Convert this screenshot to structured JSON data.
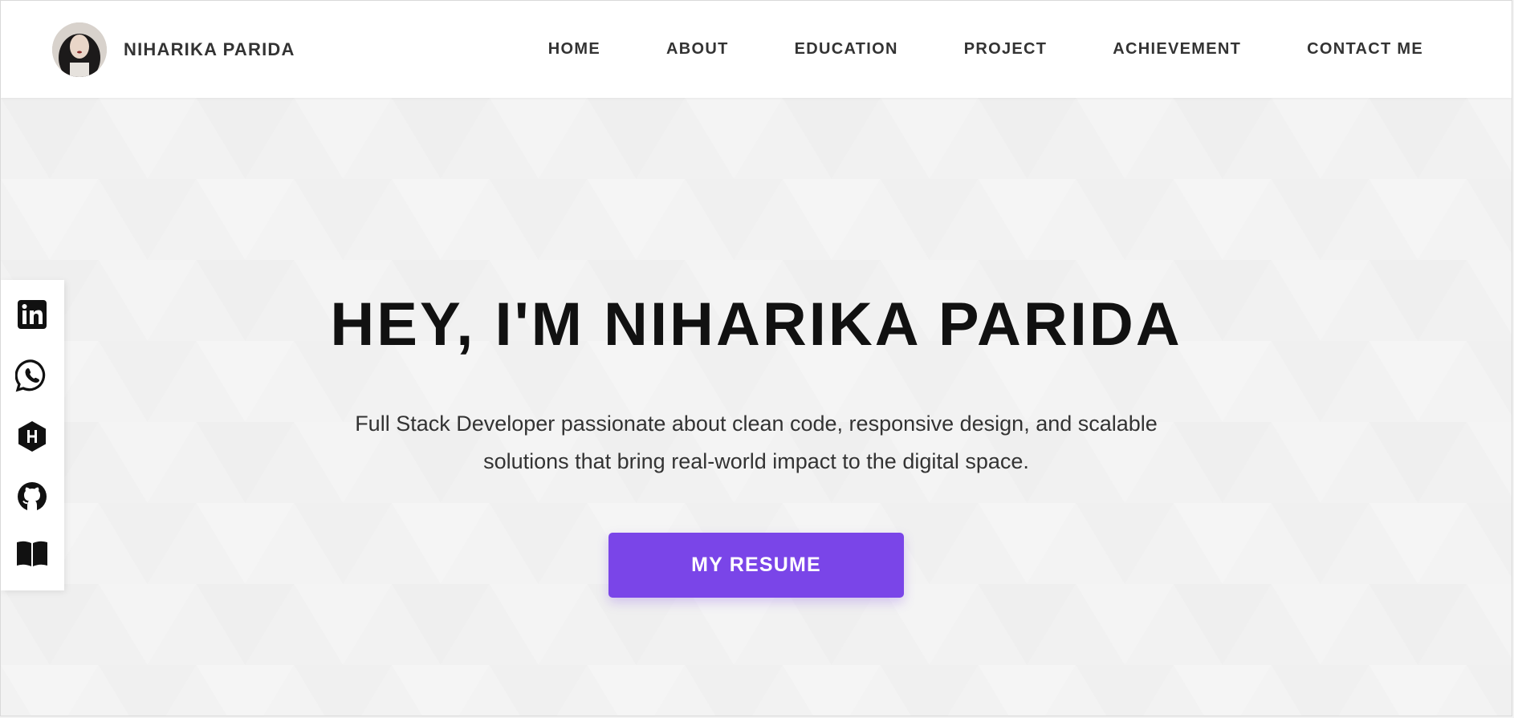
{
  "header": {
    "brand_name": "NIHARIKA PARIDA",
    "avatar_icon": "profile-photo",
    "nav": [
      {
        "label": "HOME"
      },
      {
        "label": "ABOUT"
      },
      {
        "label": "EDUCATION"
      },
      {
        "label": "PROJECT"
      },
      {
        "label": "ACHIEVEMENT"
      },
      {
        "label": "CONTACT ME"
      }
    ]
  },
  "hero": {
    "title": "HEY, I'M NIHARIKA PARIDA",
    "subtitle_line1": "Full Stack Developer passionate about clean code, responsive design, and scalable",
    "subtitle_line2": "solutions that bring real-world impact to the digital space.",
    "resume_label": "MY RESUME"
  },
  "social": [
    {
      "icon": "linkedin-icon"
    },
    {
      "icon": "whatsapp-icon"
    },
    {
      "icon": "hashnode-icon"
    },
    {
      "icon": "github-icon"
    },
    {
      "icon": "book-icon"
    }
  ],
  "colors": {
    "accent": "#7a45e8",
    "header_bg": "#ffffff",
    "hero_bg": "#f3f3f3",
    "text_dark": "#111111",
    "text_body": "#333333"
  }
}
